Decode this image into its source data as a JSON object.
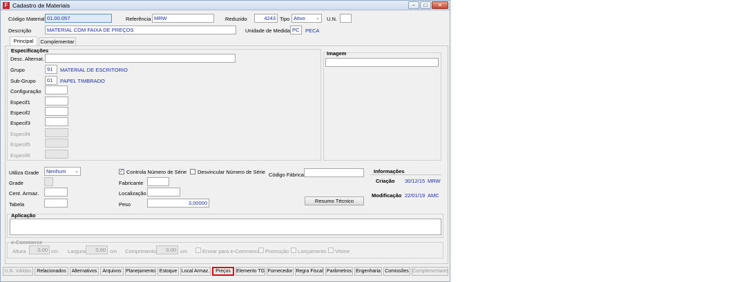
{
  "window": {
    "title": "Cadastro de Materiais",
    "app_icon": "F",
    "controls": {
      "minimize": "−",
      "maximize": "□",
      "close": "✕"
    }
  },
  "header": {
    "codigo_material_label": "Código Material",
    "codigo_material_value": "01.00.057",
    "referencia_label": "Referência",
    "referencia_value": "MRW",
    "reduzido_label": "Reduzido",
    "reduzido_value": "4243",
    "tipo_label": "Tipo",
    "tipo_value": "Ativo",
    "un_label": "U.N.",
    "un_value": "",
    "descricao_label": "Descrição",
    "descricao_value": "MATERIAL COM FAIXA DE PREÇOS",
    "unidade_medida_label": "Unidade de Medida",
    "unidade_medida_code": "PC",
    "unidade_medida_desc": "PECA"
  },
  "tabs": [
    {
      "label": "Principal"
    },
    {
      "label": "Complementar"
    }
  ],
  "especificacoes": {
    "title": "Especificações",
    "desc_alternat_label": "Desc. Alternat.",
    "grupo_label": "Grupo",
    "grupo_code": "91",
    "grupo_desc": "MATERIAL DE ESCRITORIO",
    "subgrupo_label": "Sub-Grupo",
    "subgrupo_code": "01",
    "subgrupo_desc": "PAPEL TIMBRADO",
    "configuracao_label": "Configuração",
    "especif1_label": "Especif1",
    "especif2_label": "Especif2",
    "especif3_label": "Especif3",
    "especif4_label": "Especif4",
    "especif5_label": "Especif5",
    "especif6_label": "Especif6"
  },
  "imagem": {
    "title": "Imagem"
  },
  "middle": {
    "utiliza_grade_label": "Utiliza Grade",
    "utiliza_grade_value": "Nenhum",
    "grade_label": "Grade",
    "cent_armaz_label": "Cent. Armaz.",
    "tabela_label": "Tabela",
    "controla_numero_serie_label": "Controla Número de Série",
    "desvincular_numero_serie_label": "Desvincular Número de Série",
    "fabricante_label": "Fabricante",
    "localizacao_label": "Localização",
    "peso_label": "Peso",
    "peso_value": "3,00000",
    "codigo_fabrica_label": "Código Fábrica",
    "resumo_tecnico_button": "Resumo Técnico"
  },
  "informacoes": {
    "title": "Informações",
    "criacao_label": "Criação",
    "criacao_date": "30/12/15",
    "criacao_user": "MRW",
    "modificacao_label": "Modificação",
    "modificacao_date": "22/01/19",
    "modificacao_user": "AMC"
  },
  "aplicacao": {
    "title": "Aplicação"
  },
  "ecommerce": {
    "title": "e-Commerce",
    "altura_label": "Altura",
    "altura_value": "0,00",
    "largura_label": "Largura",
    "largura_value": "0,00",
    "comprimento_label": "Comprimento",
    "comprimento_value": "0,00",
    "unit": "cm",
    "enviar_label": "Enviar para e-Commerce",
    "promocao_label": "Promoção",
    "lancamento_label": "Lançamento",
    "vitrine_label": "Vitrine"
  },
  "bottom_tabs": [
    {
      "label": "U.N. Válidas",
      "state": "disabled"
    },
    {
      "label": "Relacionados",
      "state": "normal"
    },
    {
      "label": "Alternativos",
      "state": "normal"
    },
    {
      "label": "Arquivos",
      "state": "normal"
    },
    {
      "label": "Planejamento",
      "state": "normal"
    },
    {
      "label": "Estoque",
      "state": "normal"
    },
    {
      "label": "Local Armaz.",
      "state": "normal"
    },
    {
      "label": "Preços",
      "state": "highlight"
    },
    {
      "label": "Elemento TG",
      "state": "normal"
    },
    {
      "label": "Fornecedor",
      "state": "normal"
    },
    {
      "label": "Regra Fiscal",
      "state": "normal"
    },
    {
      "label": "Parâmetros",
      "state": "normal"
    },
    {
      "label": "Engenharia",
      "state": "normal"
    },
    {
      "label": "Comissões",
      "state": "normal"
    },
    {
      "label": "Complementares",
      "state": "disabled"
    }
  ],
  "colors": {
    "value_text": "#1c2ea6",
    "highlight_border": "#e00000",
    "window_bg": "#f0f0f0"
  }
}
